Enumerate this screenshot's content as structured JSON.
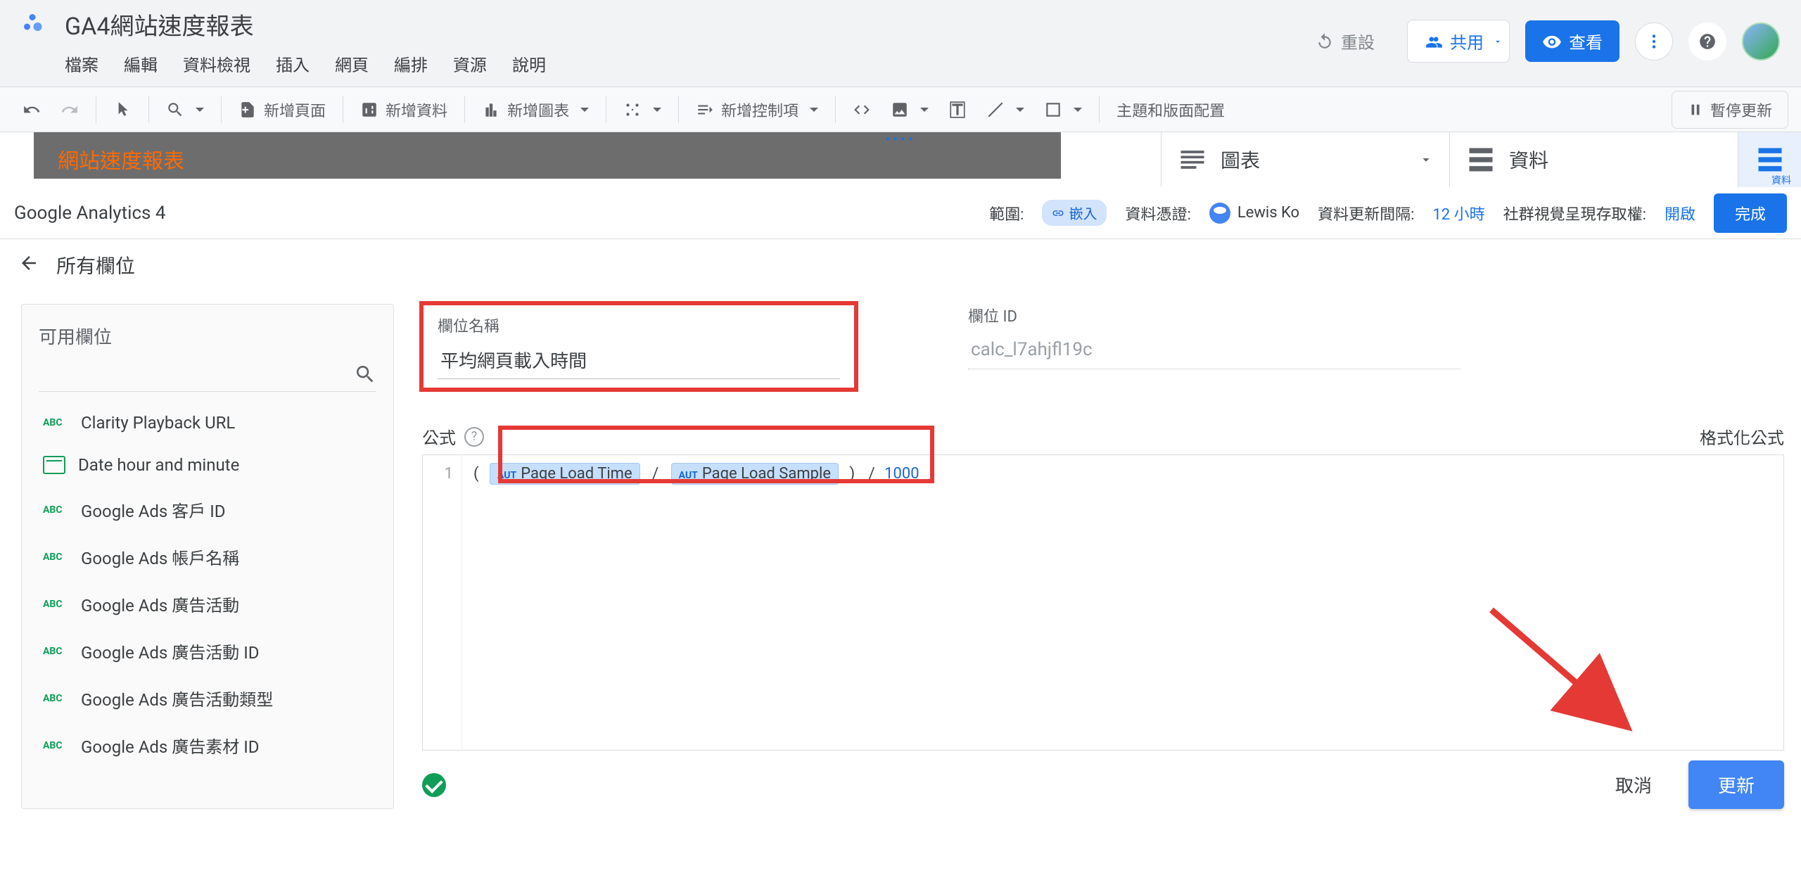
{
  "header": {
    "doc_title": "GA4網站速度報表",
    "menus": [
      "檔案",
      "編輯",
      "資料檢視",
      "插入",
      "網頁",
      "編排",
      "資源",
      "說明"
    ],
    "reset": "重設",
    "share": "共用",
    "view": "查看"
  },
  "toolbar": {
    "add_page": "新增頁面",
    "add_data": "新增資料",
    "add_chart": "新增圖表",
    "add_control": "新增控制項",
    "theme_layout": "主題和版面配置",
    "pause_update": "暫停更新"
  },
  "panel": {
    "chart": "圖表",
    "data": "資料",
    "side": "資料"
  },
  "preview_title": "網站速度報表",
  "subheader": {
    "title": "Google Analytics 4",
    "scope": "範圍:",
    "embed_chip": "嵌入",
    "cred": "資料憑證:",
    "user": "Lewis Ko",
    "refresh": "資料更新間隔:",
    "refresh_val": "12 小時",
    "community": "社群視覺呈現存取權:",
    "community_val": "開啟",
    "done": "完成"
  },
  "backrow": "所有欄位",
  "sidebar": {
    "title": "可用欄位",
    "fields": [
      {
        "type": "ABC",
        "label": "Clarity Playback URL"
      },
      {
        "type": "CAL",
        "label": "Date hour and minute"
      },
      {
        "type": "ABC",
        "label": "Google Ads 客戶 ID"
      },
      {
        "type": "ABC",
        "label": "Google Ads 帳戶名稱"
      },
      {
        "type": "ABC",
        "label": "Google Ads 廣告活動"
      },
      {
        "type": "ABC",
        "label": "Google Ads 廣告活動 ID"
      },
      {
        "type": "ABC",
        "label": "Google Ads 廣告活動類型"
      },
      {
        "type": "ABC",
        "label": "Google Ads 廣告素材 ID"
      }
    ]
  },
  "editor": {
    "name_label": "欄位名稱",
    "name_value": "平均網頁載入時間",
    "id_label": "欄位 ID",
    "id_value": "calc_l7ahjfl19c",
    "formula_label": "公式",
    "format_link": "格式化公式",
    "line_no": "1",
    "token1": "Page Load Time",
    "token2": "Page Load Sample",
    "aut": "AUT",
    "divisor": "1000",
    "cancel": "取消",
    "update": "更新"
  }
}
